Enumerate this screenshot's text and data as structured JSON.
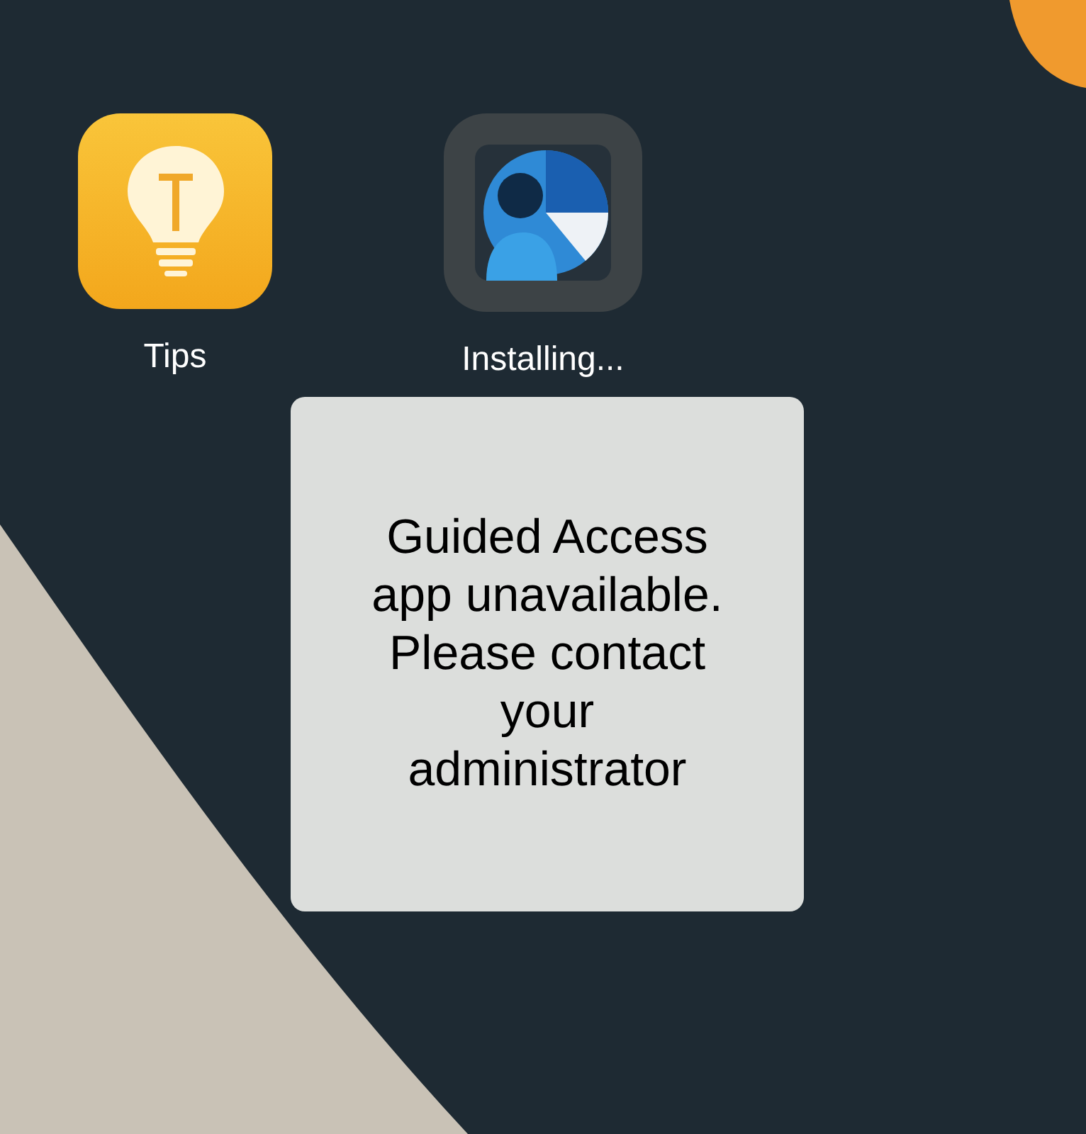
{
  "apps": [
    {
      "kind": "tips",
      "label": "Tips"
    },
    {
      "kind": "installing",
      "label": "Installing..."
    }
  ],
  "alert": {
    "lines": [
      "Guided Access",
      "app unavailable.",
      "Please contact",
      "your",
      "administrator"
    ]
  }
}
